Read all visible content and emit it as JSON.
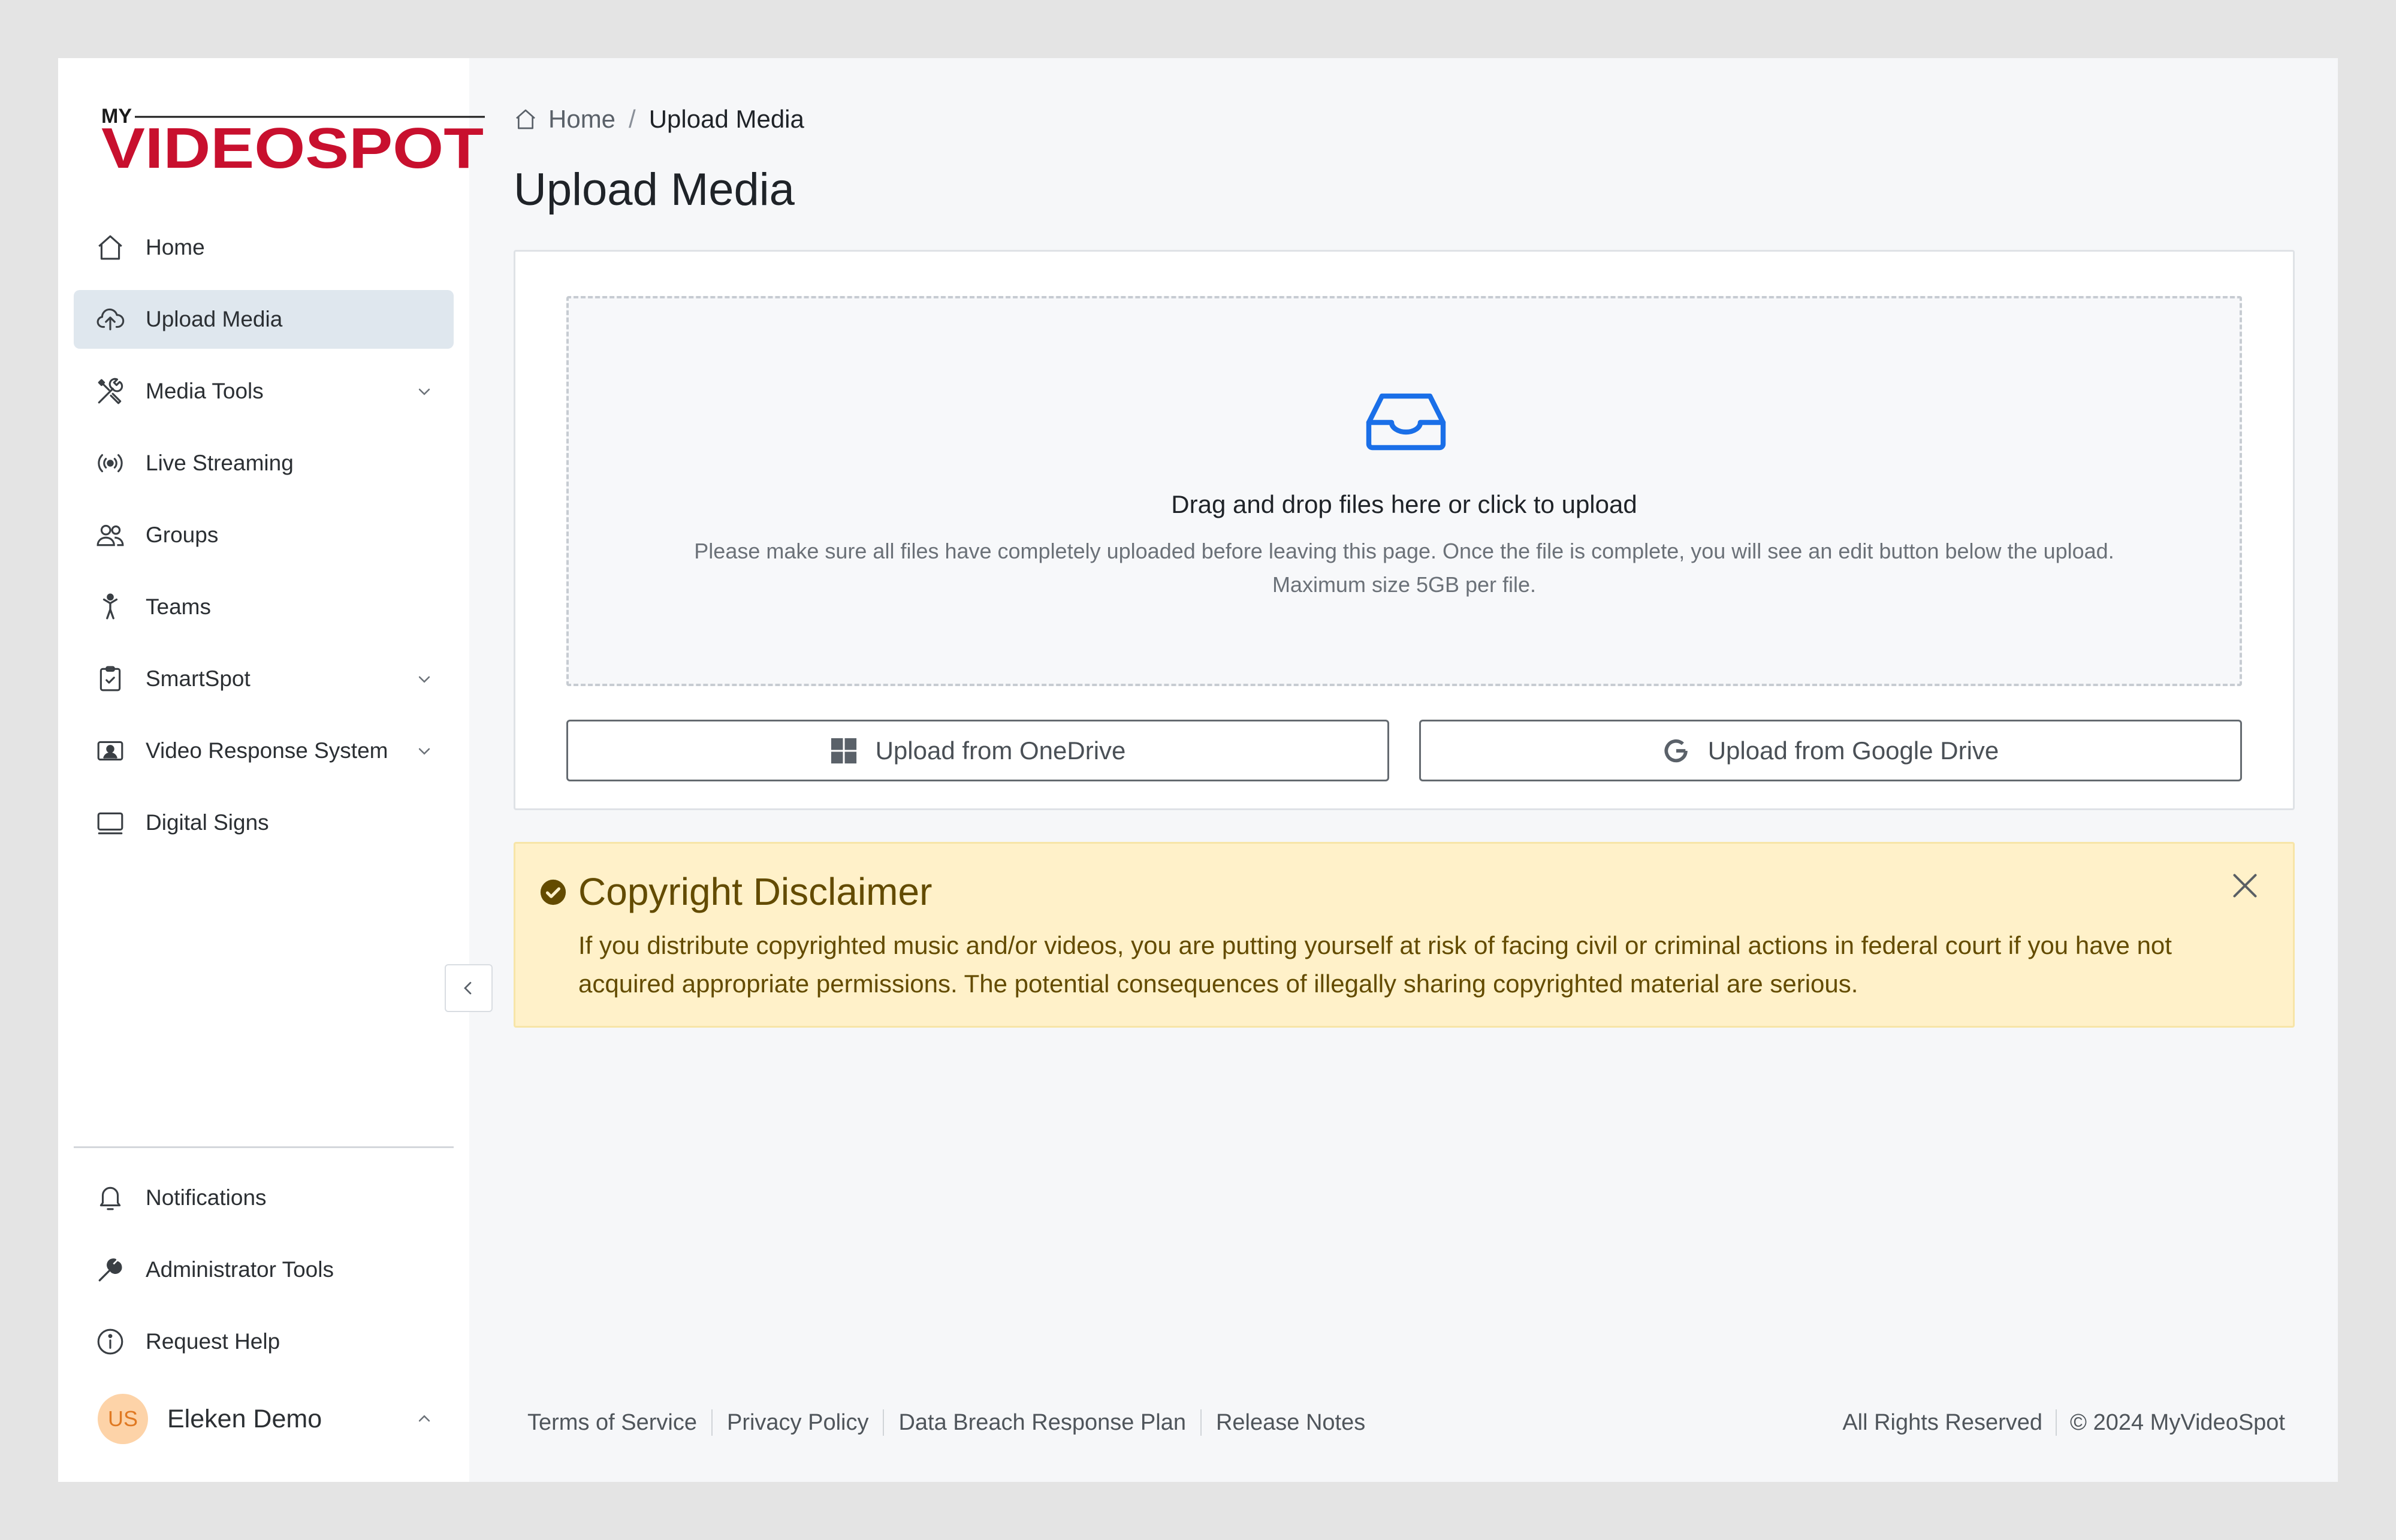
{
  "brand": {
    "logo_prefix": "MY",
    "logo_text": "VIDEOSPOT",
    "colors": {
      "red": "#c8102e",
      "dark": "#1a1a1a",
      "blue": "#1f6fd1"
    }
  },
  "sidebar": {
    "items": [
      {
        "label": "Home",
        "icon": "home-icon",
        "active": false
      },
      {
        "label": "Upload Media",
        "icon": "cloud-upload-icon",
        "active": true
      },
      {
        "label": "Media Tools",
        "icon": "tools-icon",
        "active": false,
        "expandable": true
      },
      {
        "label": "Live Streaming",
        "icon": "broadcast-icon",
        "active": false
      },
      {
        "label": "Groups",
        "icon": "users-icon",
        "active": false
      },
      {
        "label": "Teams",
        "icon": "person-icon",
        "active": false
      },
      {
        "label": "SmartSpot",
        "icon": "clipboard-check-icon",
        "active": false,
        "expandable": true
      },
      {
        "label": "Video Response System",
        "icon": "id-card-icon",
        "active": false,
        "expandable": true
      },
      {
        "label": "Digital Signs",
        "icon": "monitor-icon",
        "active": false
      }
    ],
    "bottom_items": [
      {
        "label": "Notifications",
        "icon": "bell-icon"
      },
      {
        "label": "Administrator Tools",
        "icon": "wrench-icon"
      },
      {
        "label": "Request Help",
        "icon": "info-icon"
      }
    ],
    "user": {
      "initials": "US",
      "name": "Eleken Demo"
    }
  },
  "breadcrumb": {
    "home": "Home",
    "separator": "/",
    "current": "Upload Media"
  },
  "page_title": "Upload Media",
  "upload": {
    "title": "Drag and drop files here or click to upload",
    "hint_line1": "Please make sure all files have completely uploaded before leaving this page. Once the file is complete, you will see an edit button below the upload.",
    "hint_line2": "Maximum size 5GB per file.",
    "onedrive_label": "Upload from OneDrive",
    "gdrive_label": "Upload from Google Drive"
  },
  "disclaimer": {
    "title": "Copyright Disclaimer",
    "body": "If you distribute copyrighted music and/or videos, you are putting yourself at risk of facing civil or criminal actions in federal court if you have not acquired appropriate permissions. The potential consequences of illegally sharing copyrighted material are serious."
  },
  "footer": {
    "links": [
      "Terms of Service",
      "Privacy Policy",
      "Data Breach Response Plan",
      "Release Notes"
    ],
    "rights": "All Rights Reserved",
    "copyright": "© 2024 MyVideoSpot"
  }
}
